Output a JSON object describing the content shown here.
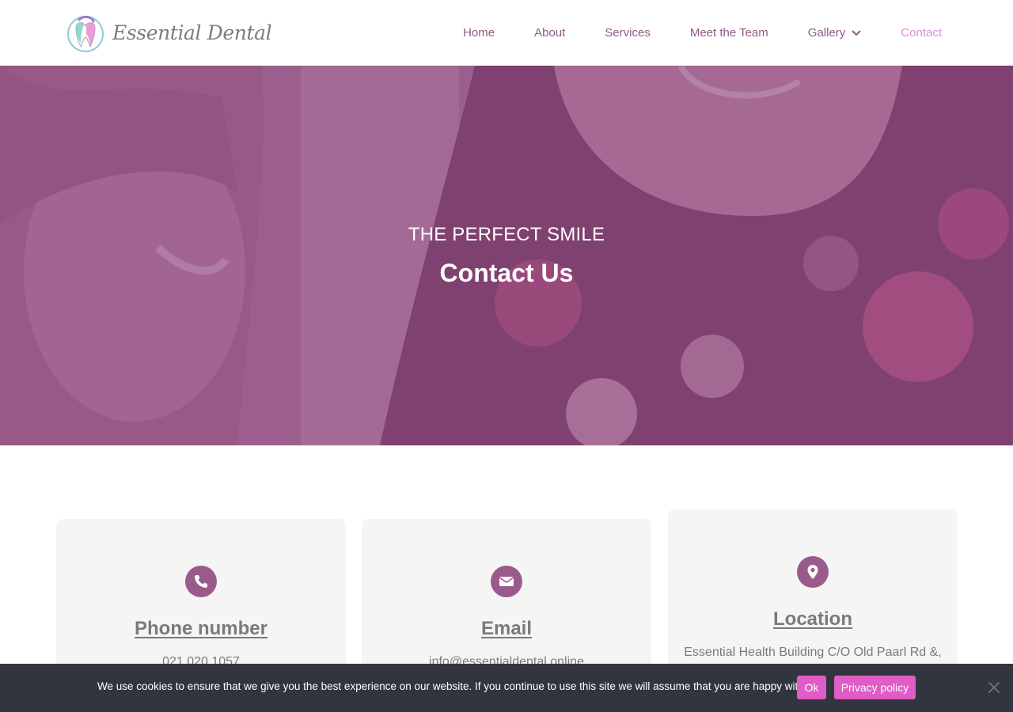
{
  "header": {
    "logo_text": "Essential Dental",
    "nav": [
      {
        "label": "Home"
      },
      {
        "label": "About"
      },
      {
        "label": "Services"
      },
      {
        "label": "Meet the Team"
      },
      {
        "label": "Gallery",
        "has_dropdown": true
      },
      {
        "label": "Contact",
        "active": true
      }
    ]
  },
  "hero": {
    "subtitle": "THE PERFECT SMILE",
    "title": "Contact Us"
  },
  "cards": [
    {
      "icon": "phone-icon",
      "title": "Phone number",
      "text": "021 020 1057"
    },
    {
      "icon": "envelope-icon",
      "title": "Email",
      "text": "info@essentialdental.online"
    },
    {
      "icon": "map-pin-icon",
      "title": "Location",
      "text": "Essential Health Building C/O Old Paarl Rd &,"
    }
  ],
  "cookie": {
    "message": "We use cookies to ensure that we give you the best experience on our website. If you continue to use this site we will assume that you are happy with it.",
    "ok_label": "Ok",
    "privacy_label": "Privacy policy"
  },
  "colors": {
    "brand": "#9b5a8c",
    "nav_text": "#8e5a86",
    "nav_active": "#e58ad3",
    "button": "#e05cc6",
    "cookie_bg": "#32353d",
    "card_bg": "#f5f5f5"
  }
}
